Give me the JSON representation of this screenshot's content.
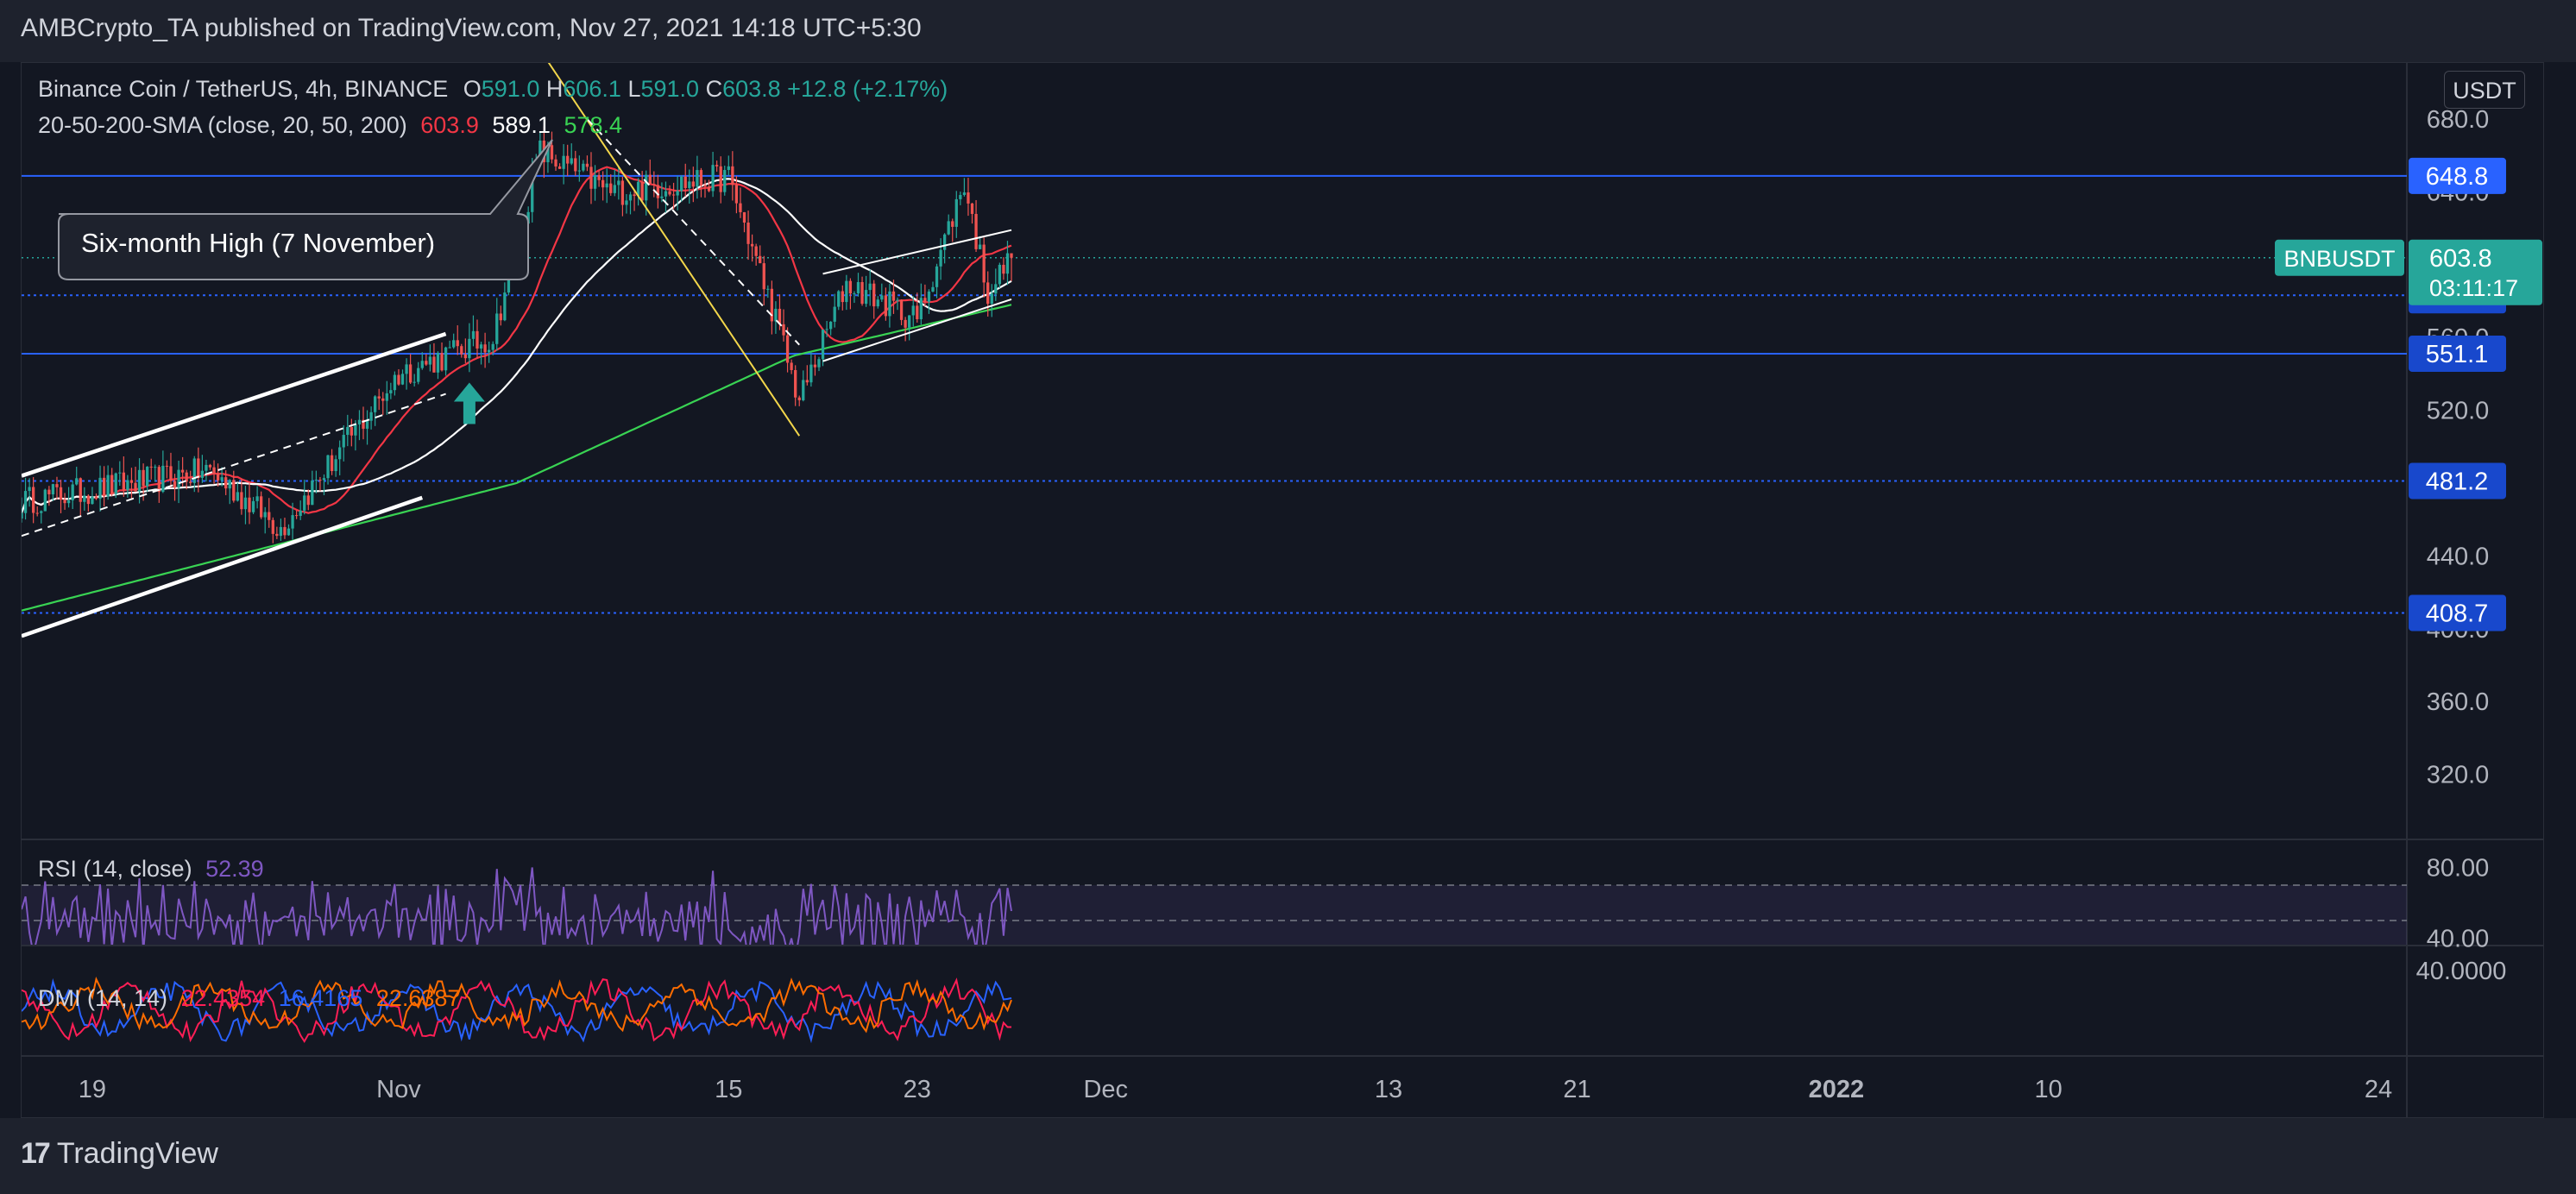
{
  "header": {
    "published": "AMBCrypto_TA published on TradingView.com, Nov 27, 2021 14:18 UTC+5:30"
  },
  "footer": {
    "brand": "TradingView"
  },
  "main_chart": {
    "symbol_line": "Binance Coin / TetherUS, 4h, BINANCE",
    "ohlc": {
      "o_label": "O",
      "o": "591.0",
      "h_label": "H",
      "h": "606.1",
      "l_label": "L",
      "l": "591.0",
      "c_label": "C",
      "c": "603.8",
      "change": "+12.8 (+2.17%)"
    },
    "sma_label": "20-50-200-SMA (close, 20, 50, 200)",
    "sma_values": {
      "sma20": "603.9",
      "sma50": "589.1",
      "sma200": "578.4"
    },
    "currency": "USDT",
    "annotation": "Six-month High (7 November)",
    "price_tag": {
      "symbol": "BNBUSDT",
      "price": "603.8",
      "countdown": "03:11:17"
    },
    "levels": [
      {
        "label": "648.8",
        "value": 648.8
      },
      {
        "label": "583.2",
        "value": 583.2
      },
      {
        "label": "551.1",
        "value": 551.1
      },
      {
        "label": "481.2",
        "value": 481.2
      },
      {
        "label": "408.7",
        "value": 408.7
      }
    ],
    "y_ticks": [
      "680.0",
      "640.0",
      "600.0",
      "560.0",
      "520.0",
      "480.0",
      "440.0",
      "400.0",
      "360.0",
      "320.0"
    ],
    "x_ticks": [
      "19",
      "Nov",
      "15",
      "23",
      "Dec",
      "13",
      "21",
      "2022",
      "10",
      "24"
    ]
  },
  "rsi": {
    "label": "RSI (14, close)",
    "value": "52.39",
    "ticks": [
      "80.00",
      "40.00"
    ]
  },
  "dmi": {
    "label": "DMI (14, 14)",
    "plus": "22.4354",
    "minus": "16.4165",
    "adx": "22.6387",
    "tick": "40.0000"
  },
  "colors": {
    "up": "#26a69a",
    "down": "#ef5350",
    "sma20": "#f23645",
    "sma50": "#ffffff",
    "sma200": "#39d353",
    "level": "#2962ff",
    "rsi": "#7e57c2",
    "dmi_plus": "#2962ff",
    "dmi_minus": "#ff1e56",
    "adx": "#ff6d00"
  },
  "chart_data": {
    "type": "candlestick",
    "title": "Binance Coin / TetherUS, 4h, BINANCE",
    "x_range": [
      "2021-10-16",
      "2022-01-28"
    ],
    "ylim": [
      280,
      700
    ],
    "close_path_key_points": [
      {
        "x": "2021-10-16",
        "y": 470
      },
      {
        "x": "2021-10-24",
        "y": 487
      },
      {
        "x": "2021-10-27",
        "y": 455
      },
      {
        "x": "2021-11-01",
        "y": 540
      },
      {
        "x": "2021-11-05",
        "y": 560
      },
      {
        "x": "2021-11-07",
        "y": 662
      },
      {
        "x": "2021-11-10",
        "y": 640
      },
      {
        "x": "2021-11-15",
        "y": 648
      },
      {
        "x": "2021-11-17",
        "y": 570
      },
      {
        "x": "2021-11-18",
        "y": 525
      },
      {
        "x": "2021-11-20",
        "y": 590
      },
      {
        "x": "2021-11-23",
        "y": 570
      },
      {
        "x": "2021-11-25",
        "y": 645
      },
      {
        "x": "2021-11-26",
        "y": 585
      },
      {
        "x": "2021-11-27",
        "y": 603.8
      }
    ],
    "last": {
      "open": 591.0,
      "high": 606.1,
      "low": 591.0,
      "close": 603.8
    }
  }
}
